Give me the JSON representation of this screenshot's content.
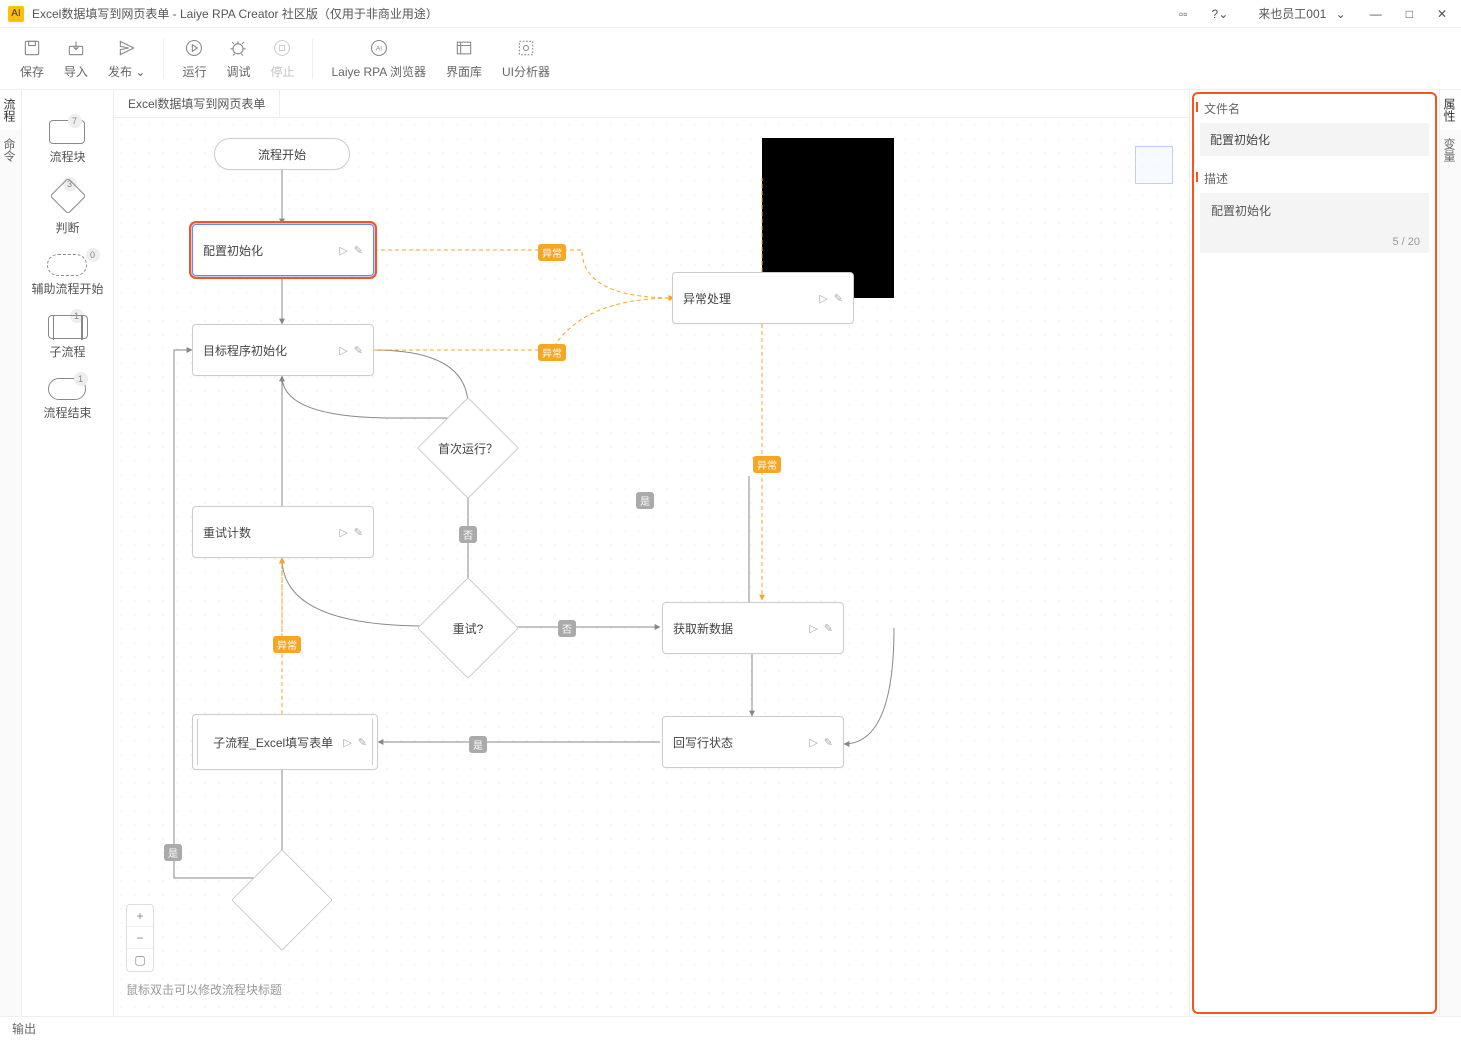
{
  "titlebar": {
    "title": "Excel数据填写到网页表单 - Laiye RPA Creator 社区版（仅用于非商业用途）",
    "user": "来也员工001"
  },
  "toolbar": {
    "save": "保存",
    "import": "导入",
    "publish": "发布",
    "run": "运行",
    "debug": "调试",
    "stop": "停止",
    "browser": "Laiye RPA 浏览器",
    "lib": "界面库",
    "analyzer": "UI分析器"
  },
  "sidetabs_left": {
    "flow": "流程",
    "cmd": "命令"
  },
  "palette": {
    "block": {
      "label": "流程块",
      "badge": "7"
    },
    "judge": {
      "label": "判断",
      "badge": "3"
    },
    "aux": {
      "label": "辅助流程开始",
      "badge": "0"
    },
    "sub": {
      "label": "子流程",
      "badge": "1"
    },
    "end": {
      "label": "流程结束",
      "badge": "1"
    }
  },
  "tab": {
    "active": "Excel数据填写到网页表单"
  },
  "nodes": {
    "start": "流程开始",
    "configInit": "配置初始化",
    "targetInit": "目标程序初始化",
    "retryCount": "重试计数",
    "firstRun": "首次运行？",
    "retry": "重试?",
    "exception": "异常处理",
    "fetchData": "获取新数据",
    "writeStatus": "回写行状态",
    "subExcel": "子流程_Excel填写表单"
  },
  "edgeBadges": {
    "exception": "异常",
    "no": "否",
    "yes": "是"
  },
  "hint": "鼠标双击可以修改流程块标题",
  "props": {
    "filenameLabel": "文件名",
    "filenameValue": "配置初始化",
    "descLabel": "描述",
    "descValue": "配置初始化",
    "counter": "5 / 20"
  },
  "sidetabs_right": {
    "attr": "属性",
    "var": "变量"
  },
  "footer": {
    "output": "输出"
  }
}
